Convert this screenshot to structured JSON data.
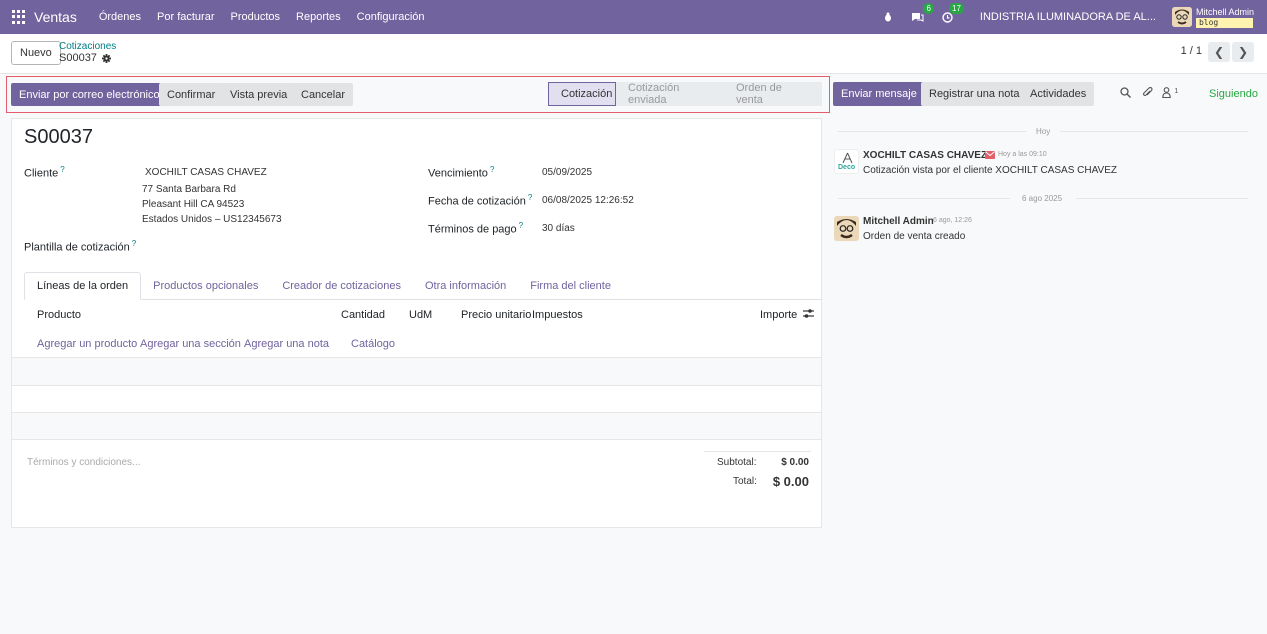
{
  "navbar": {
    "app_name": "Ventas",
    "menu": [
      "Órdenes",
      "Por facturar",
      "Productos",
      "Reportes",
      "Configuración"
    ],
    "messages_badge": "6",
    "activities_badge": "17",
    "company": "INDISTRIA ILUMINADORA DE AL...",
    "user_name": "Mitchell Admin",
    "db_name": "blog",
    "bar_color": "#71639e"
  },
  "control_panel": {
    "new_label": "Nuevo",
    "breadcrumb_parent": "Cotizaciones",
    "breadcrumb_current": "S00037",
    "pager": "1 / 1"
  },
  "statusbar": {
    "send_email": "Enviar por correo electrónico",
    "confirm": "Confirmar",
    "preview": "Vista previa",
    "cancel": "Cancelar",
    "stages": [
      "Cotización",
      "Cotización enviada",
      "Orden de venta"
    ],
    "active_stage": "Cotización"
  },
  "chatter": {
    "send_message": "Enviar mensaje",
    "log_note": "Registrar una nota",
    "activities": "Actividades",
    "followers_count": "1",
    "following": "Siguiendo",
    "sep_today": "Hoy",
    "sep_date": "6 ago 2025",
    "messages": [
      {
        "author": "XOCHILT CASAS CHAVEZ",
        "time": "Hoy a las 09:10",
        "body": "Cotización vista por el cliente XOCHILT CASAS CHAVEZ",
        "avatar_text": "Deco"
      },
      {
        "author": "Mitchell Admin",
        "time": "6 ago, 12:26",
        "body": "Orden de venta creado"
      }
    ]
  },
  "form": {
    "name": "S00037",
    "customer_label": "Cliente",
    "customer_name": "XOCHILT CASAS CHAVEZ",
    "address_1": "77 Santa Barbara Rd",
    "address_2": "Pleasant Hill CA 94523",
    "address_3": "Estados Unidos – US12345673",
    "template_label": "Plantilla de cotización",
    "expiration_label": "Vencimiento",
    "expiration_value": "05/09/2025",
    "quote_date_label": "Fecha de cotización",
    "quote_date_value": "06/08/2025 12:26:52",
    "payment_terms_label": "Términos de pago",
    "payment_terms_value": "30 días",
    "tabs": [
      "Líneas de la orden",
      "Productos opcionales",
      "Creador de cotizaciones",
      "Otra información",
      "Firma del cliente"
    ],
    "columns": [
      "Producto",
      "Cantidad",
      "UdM",
      "Precio unitario",
      "Impuestos",
      "Importe"
    ],
    "add_links": [
      "Agregar un producto",
      "Agregar una sección",
      "Agregar una nota",
      "Catálogo"
    ],
    "terms_placeholder": "Términos y condiciones...",
    "subtotal_label": "Subtotal:",
    "subtotal_value": "$ 0.00",
    "total_label": "Total:",
    "total_value": "$ 0.00"
  }
}
